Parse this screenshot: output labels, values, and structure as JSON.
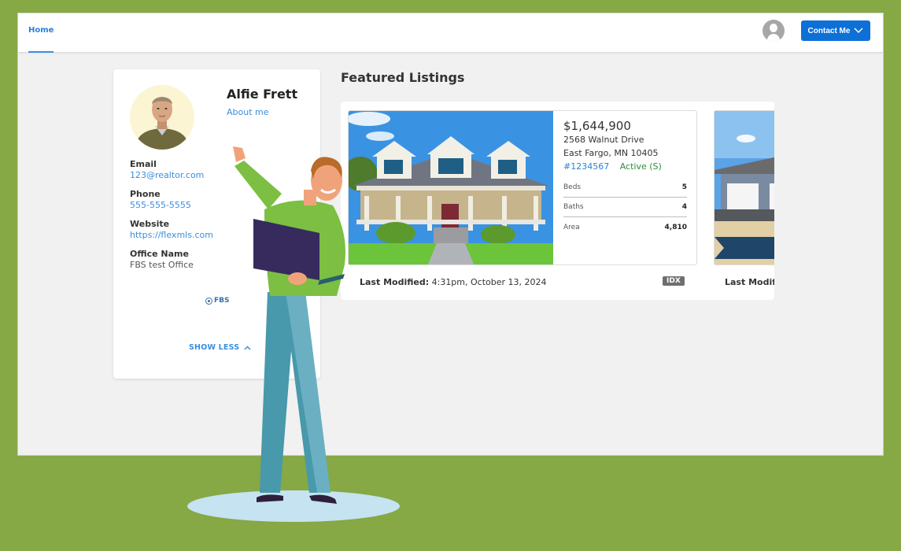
{
  "nav": {
    "tabs": [
      {
        "label": "Home",
        "active": true
      }
    ],
    "contact_button": "Contact Me",
    "accent_color": "#0c70d6"
  },
  "agent": {
    "name": "Alfie Frett",
    "about_link": "About me",
    "fields": [
      {
        "label": "Email",
        "value": "123@realtor.com"
      },
      {
        "label": "Phone",
        "value": "555-555-5555"
      },
      {
        "label": "Website",
        "value": "https://flexmls.com"
      },
      {
        "label": "Office Name",
        "value": "FBS test Office"
      }
    ],
    "brand_logo": "FBS",
    "toggle_label": "SHOW LESS"
  },
  "featured": {
    "title": "Featured Listings",
    "listings": [
      {
        "price": "$1,644,900",
        "street": "2568 Walnut Drive",
        "city": "East Fargo, MN 10405",
        "mls_number": "#1234567",
        "status": "Active (S)",
        "specs": [
          {
            "label": "Beds",
            "value": "5"
          },
          {
            "label": "Baths",
            "value": "4"
          },
          {
            "label": "Area",
            "value": "4,810"
          }
        ],
        "last_modified_label": "Last Modified:",
        "last_modified_value": "4:31pm, October 13, 2024",
        "badge": "IDX"
      },
      {
        "last_modified_label": "Last Modif"
      }
    ]
  }
}
